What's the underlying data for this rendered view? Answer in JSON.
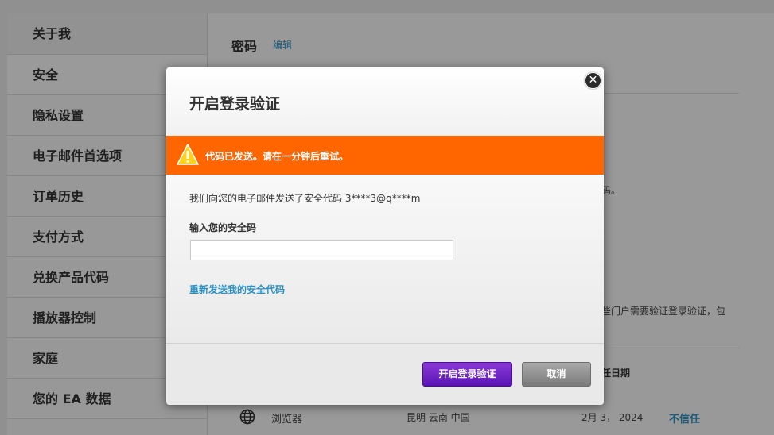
{
  "sidebar": {
    "items": [
      {
        "label": "关于我"
      },
      {
        "label": "安全"
      },
      {
        "label": "隐私设置"
      },
      {
        "label": "电子邮件首选项"
      },
      {
        "label": "订单历史"
      },
      {
        "label": "支付方式"
      },
      {
        "label": "兑换产品代码"
      },
      {
        "label": "播放器控制"
      },
      {
        "label": "家庭"
      },
      {
        "label": "您的 EA 数据"
      }
    ]
  },
  "main": {
    "password_title": "密码",
    "edit_link": "编辑",
    "partial_text_1": "码。",
    "partial_text_2": "些门户需要验证登录验证，包",
    "partial_header": "任日期",
    "device_row": {
      "icon": "globe-icon",
      "device": "浏览器",
      "location": "昆明 云南 中国",
      "date": "2月 3， 2024",
      "untrust_label": "不信任"
    }
  },
  "modal": {
    "title": "开启登录验证",
    "alert": {
      "icon": "warning-icon",
      "message": "代码已发送。请在一分钟后重试。",
      "color": "#ff6600"
    },
    "body_text": "我们向您的电子邮件发送了安全代码 3****3@q****m",
    "code_label": "输入您的安全码",
    "code_value": "",
    "resend_link": "重新发送我的安全代码",
    "primary_button": "开启登录验证",
    "cancel_button": "取消",
    "accent_color": "#6a1fc6"
  }
}
